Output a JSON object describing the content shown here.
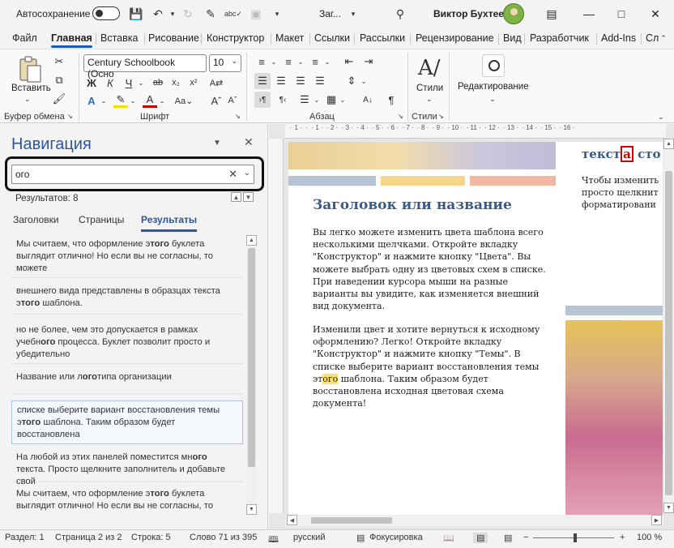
{
  "titlebar": {
    "autosave_label": "Автосохранение",
    "doc_title": "Заг...",
    "user_name": "Виктор Бухтеев"
  },
  "menu": {
    "items": [
      "Файл",
      "Главная",
      "Вставка",
      "Рисование",
      "Конструктор",
      "Макет",
      "Ссылки",
      "Рассылки",
      "Рецензирование",
      "Вид",
      "Разработчик",
      "Add-Ins",
      "Сл"
    ],
    "active": "Главная"
  },
  "ribbon": {
    "paste_label": "Вставить",
    "font_name": "Century Schoolbook (Осно",
    "font_size": "10",
    "styles_label": "Стили",
    "editing_label": "Редактирование",
    "groups": {
      "clipboard": "Буфер обмена",
      "font": "Шрифт",
      "paragraph": "Абзац",
      "styles": "Стили"
    }
  },
  "nav": {
    "title": "Навигация",
    "search_value": "ого",
    "results_count": "Результатов: 8",
    "tabs": [
      "Заголовки",
      "Страницы",
      "Результаты"
    ],
    "active_tab": "Результаты",
    "results": [
      {
        "pre": "Мы считаем, что оформление э",
        "hit": "того",
        "post": " буклета выглядит отлично! Но если вы не согласны, то можете"
      },
      {
        "pre": "внешнего вида представлены в образцах текста э",
        "hit": "того",
        "post": " шаблона."
      },
      {
        "pre": "но не более, чем это допускается в рамках учебн",
        "hit": "ого",
        "post": " процесса. Буклет позволит просто и убедительно"
      },
      {
        "pre": "Название или л",
        "hit": "ого",
        "post": "типа организации"
      },
      {
        "pre": "списке выберите вариант восстановления темы э",
        "hit": "того",
        "post": " шаблона. Таким образом будет восстановлена"
      },
      {
        "pre": "На любой из этих панелей поместится мн",
        "hit": "ого",
        "post": " текста. Просто щелкните заполнитель и добавьте свой"
      },
      {
        "pre": "Мы считаем, что оформление э",
        "hit": "того",
        "post": " буклета выглядит отлично! Но если вы не согласны, то можете"
      }
    ]
  },
  "document": {
    "heading": "Заголовок или название",
    "para1": "Вы легко можете изменить цвета шаблона всего несколькими щелчками. Откройте вкладку \"Конструктор\" и нажмите кнопку \"Цвета\". Вы можете выбрать одну из цветовых схем в списке. При наведении курсора мыши на разные варианты вы увидите, как изменяется внешний вид документа.",
    "para2_pre": "Изменили цвет и хотите вернуться к исходному оформлению? Легко! Откройте вкладку \"Конструктор\" и нажмите кнопку \"Темы\". В списке выберите вариант восстановления темы эт",
    "para2_hit": "ого",
    "para2_post": " шаблона. Таким образом будет восстановлена исходная цветовая схема документа!",
    "right_title_pre": "текст",
    "right_title_box": "а",
    "right_title_post": " сто",
    "right_text": [
      "Чтобы изменить",
      "просто щелкнит",
      "форматировани"
    ],
    "bar_colors": [
      "#b8c3d3",
      "#f5d58a",
      "#f0b8a0"
    ]
  },
  "status": {
    "section": "Раздел: 1",
    "page": "Страница 2 из 2",
    "line": "Строка: 5",
    "words": "Слово 71 из 395",
    "language": "русский",
    "focus": "Фокусировка",
    "zoom_minus": "−",
    "zoom_plus": "+",
    "zoom": "100 %"
  }
}
